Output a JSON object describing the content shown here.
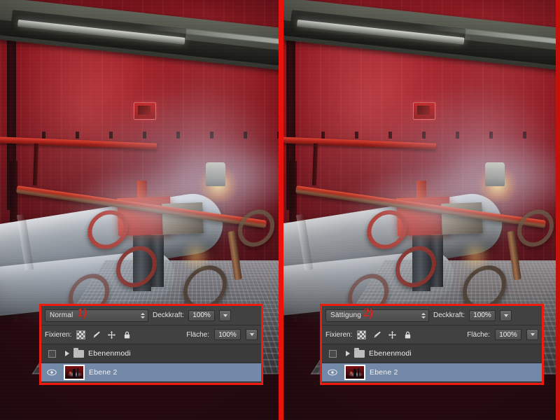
{
  "app": {
    "context": "photoshop-layers-panel-comparison",
    "annotations": [
      {
        "id": "1",
        "label": "1)"
      },
      {
        "id": "2",
        "label": "2)"
      }
    ]
  },
  "panels": [
    {
      "id": "left",
      "blend_mode": "Normal",
      "opacity_label": "Deckkraft:",
      "opacity_value": "100%",
      "lock_label": "Fixieren:",
      "fill_label": "Fläche:",
      "fill_value": "100%",
      "lock_icons": [
        "transparency-checker-icon",
        "brush-icon",
        "move-icon",
        "lock-icon"
      ],
      "layers": [
        {
          "name": "Ebenenmodi",
          "type": "group",
          "visible": false,
          "selected": false,
          "expander": "collapsed"
        },
        {
          "name": "Ebene 2",
          "type": "image",
          "visible": true,
          "selected": true,
          "expander": "none"
        }
      ]
    },
    {
      "id": "right",
      "blend_mode": "Sättigung",
      "opacity_label": "Deckkraft:",
      "opacity_value": "100%",
      "lock_label": "Fixieren:",
      "fill_label": "Fläche:",
      "fill_value": "100%",
      "lock_icons": [
        "transparency-checker-icon",
        "brush-icon",
        "move-icon",
        "lock-icon"
      ],
      "layers": [
        {
          "name": "Ebenenmodi",
          "type": "group",
          "visible": false,
          "selected": false,
          "expander": "collapsed"
        },
        {
          "name": "Ebene 2",
          "type": "image",
          "visible": true,
          "selected": true,
          "expander": "none"
        }
      ]
    }
  ],
  "images": {
    "left": {
      "caption": "industrial boiler room with red wall, steam and valve machinery",
      "blend_state": "Normal"
    },
    "right": {
      "caption": "same industrial boiler room rendered with Sättigung blend mode",
      "blend_state": "Sättigung"
    }
  },
  "colors": {
    "annotation_red": "#e0231a",
    "frame_red": "#ef1a10",
    "panel_background": "#414141",
    "layer_selected": "#7389a8",
    "wall_red": "#8a1018"
  }
}
